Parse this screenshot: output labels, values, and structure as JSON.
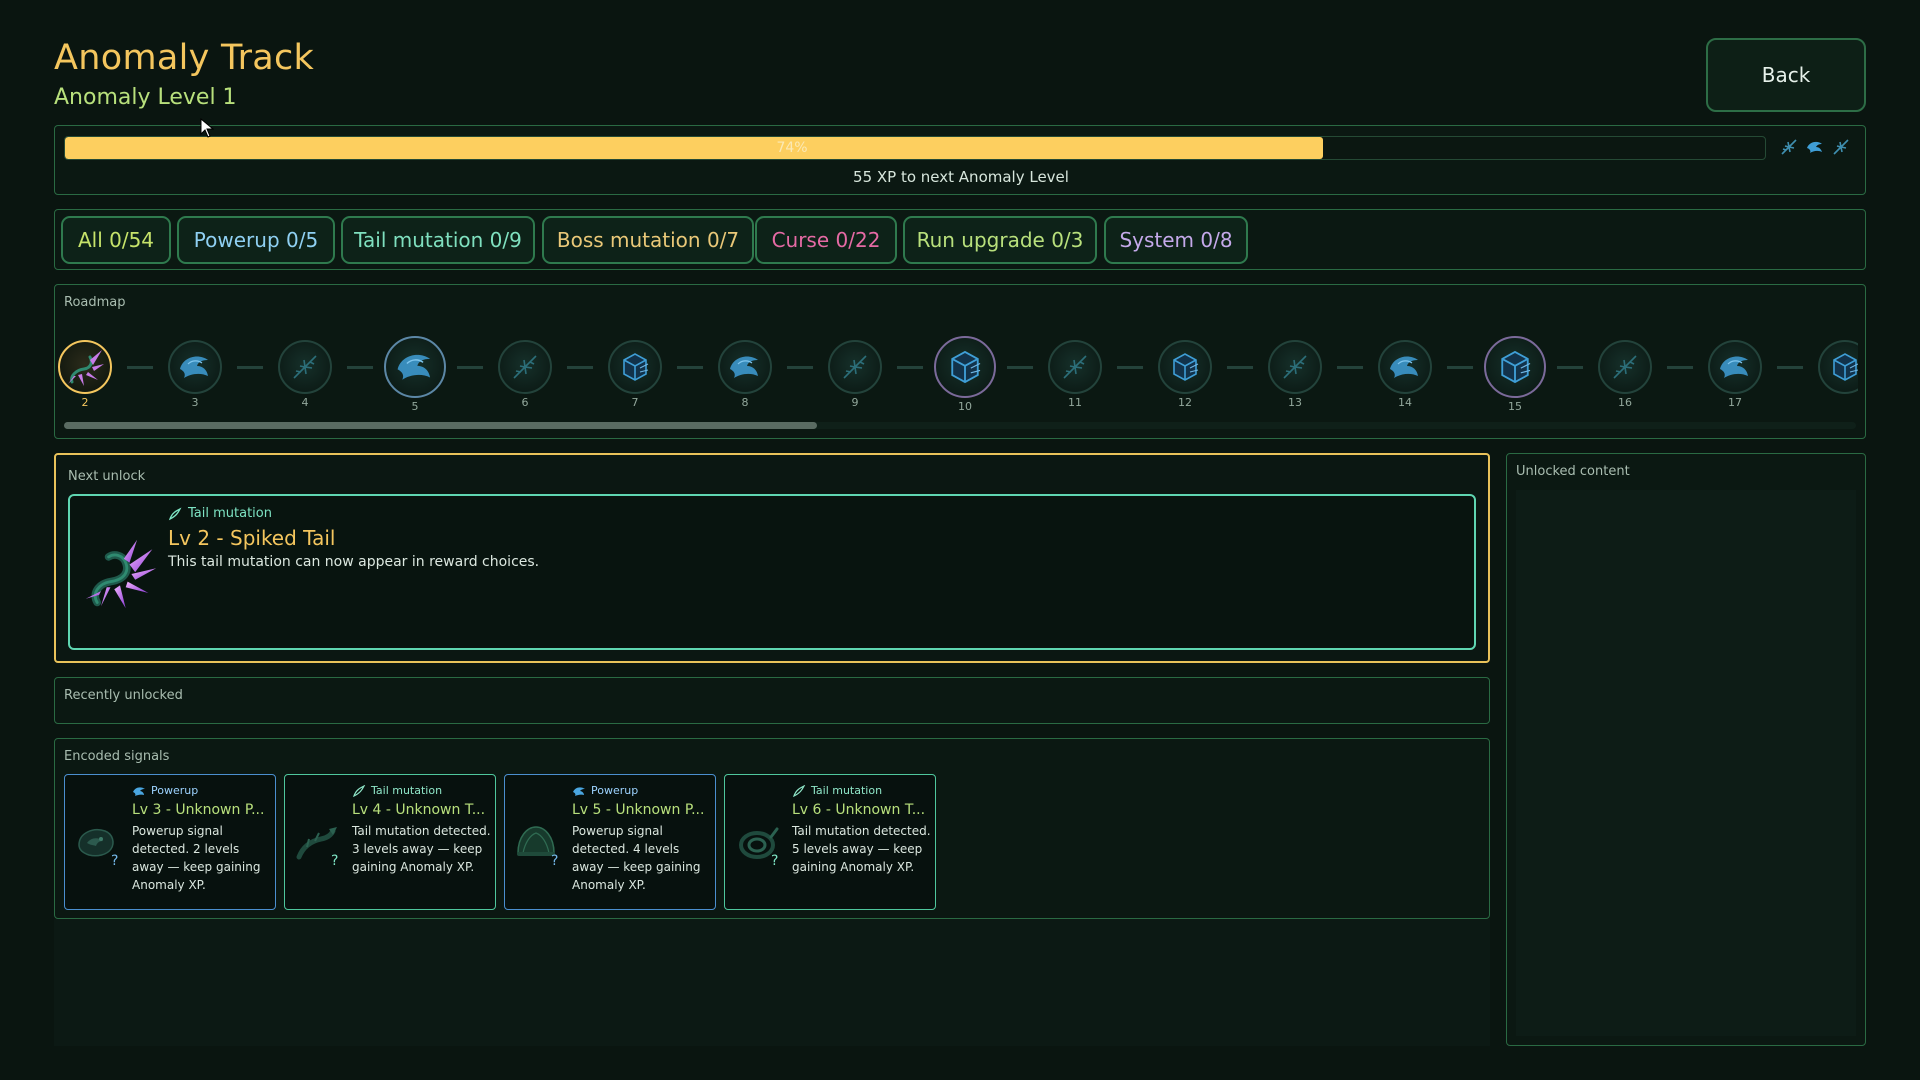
{
  "header": {
    "title": "Anomaly Track",
    "subtitle": "Anomaly Level 1",
    "back_label": "Back"
  },
  "progress": {
    "percent": 74,
    "percent_label": "74%",
    "xp_text": "55 XP to next Anomaly Level"
  },
  "tabs": [
    {
      "label": "All 0/54",
      "color": "#c6e36a"
    },
    {
      "label": "Powerup 0/5",
      "color": "#8fd0f2"
    },
    {
      "label": "Tail mutation 0/9",
      "color": "#7fe0bf"
    },
    {
      "label": "Boss mutation 0/7",
      "color": "#e9c878"
    },
    {
      "label": "Curse 0/22",
      "color": "#e56aa4"
    },
    {
      "label": "Run upgrade 0/3",
      "color": "#b8e07c"
    },
    {
      "label": "System 0/8",
      "color": "#c4a9ea"
    }
  ],
  "roadmap": {
    "label": "Roadmap",
    "nodes": [
      {
        "level": "2",
        "icon": "spikes-icon",
        "kind": "current"
      },
      {
        "level": "3",
        "icon": "dragon-icon",
        "kind": "normal"
      },
      {
        "level": "4",
        "icon": "spikes-icon",
        "kind": "normal"
      },
      {
        "level": "5",
        "icon": "dragon-icon",
        "kind": "major"
      },
      {
        "level": "6",
        "icon": "spikes-icon",
        "kind": "normal"
      },
      {
        "level": "7",
        "icon": "cube-icon",
        "kind": "normal"
      },
      {
        "level": "8",
        "icon": "dragon-icon",
        "kind": "normal"
      },
      {
        "level": "9",
        "icon": "spikes-icon",
        "kind": "normal"
      },
      {
        "level": "10",
        "icon": "cube-icon",
        "kind": "boss"
      },
      {
        "level": "11",
        "icon": "spikes-icon",
        "kind": "normal"
      },
      {
        "level": "12",
        "icon": "cube-icon",
        "kind": "normal"
      },
      {
        "level": "13",
        "icon": "spikes-icon",
        "kind": "normal"
      },
      {
        "level": "14",
        "icon": "dragon-icon",
        "kind": "normal"
      },
      {
        "level": "15",
        "icon": "cube-icon",
        "kind": "boss"
      },
      {
        "level": "16",
        "icon": "spikes-icon",
        "kind": "normal"
      },
      {
        "level": "17",
        "icon": "dragon-icon",
        "kind": "normal"
      },
      {
        "level": "",
        "icon": "cube-icon",
        "kind": "normal"
      }
    ],
    "scroll_fraction": 0.42
  },
  "next_unlock": {
    "label": "Next unlock",
    "category": "Tail mutation",
    "title": "Lv 2 - Spiked Tail",
    "description": "This tail mutation can now appear in reward choices.",
    "icon": "spiked-tail-icon"
  },
  "recently_unlocked": {
    "label": "Recently unlocked"
  },
  "encoded_signals": {
    "label": "Encoded signals",
    "cards": [
      {
        "category": "Powerup",
        "kind": "pow",
        "title": "Lv 3 - Unknown P...",
        "description": "Powerup signal detected. 2 levels away — keep gaining Anomaly XP.",
        "icon": "dragon-silhouette-icon",
        "q": "?"
      },
      {
        "category": "Tail mutation",
        "kind": "tail",
        "title": "Lv 4 - Unknown T...",
        "description": "Tail mutation detected. 3 levels away — keep gaining Anomaly XP.",
        "icon": "tail-silhouette-icon",
        "q": "?"
      },
      {
        "category": "Powerup",
        "kind": "pow",
        "title": "Lv 5 - Unknown P...",
        "description": "Powerup signal detected. 4 levels away — keep gaining Anomaly XP.",
        "icon": "shell-silhouette-icon",
        "q": "?"
      },
      {
        "category": "Tail mutation",
        "kind": "tail",
        "title": "Lv 6 - Unknown T...",
        "description": "Tail mutation detected. 5 levels away — keep gaining Anomaly XP.",
        "icon": "coil-silhouette-icon",
        "q": "?"
      }
    ]
  },
  "unlocked_content": {
    "label": "Unlocked content"
  }
}
